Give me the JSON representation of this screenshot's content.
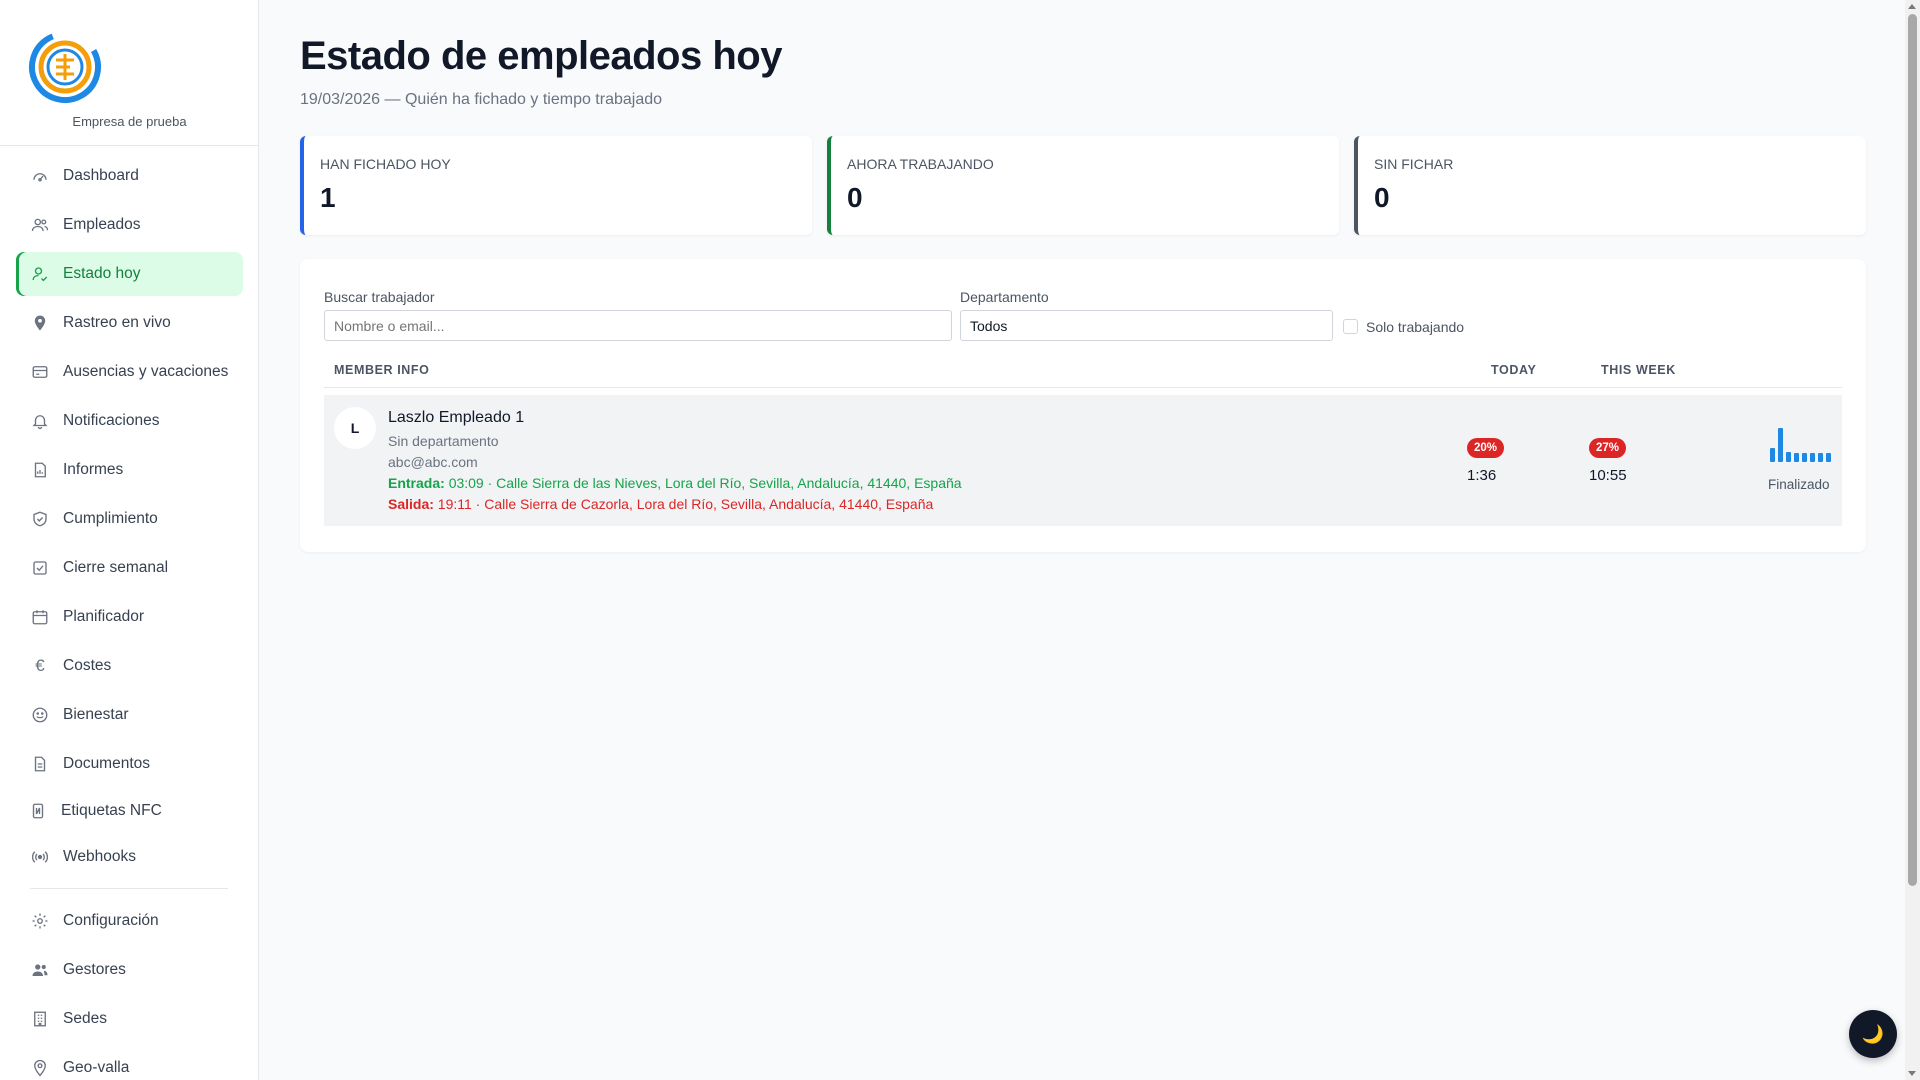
{
  "sidebar": {
    "company": "Empresa de prueba",
    "items": [
      {
        "label": "Dashboard",
        "icon": "gauge-icon"
      },
      {
        "label": "Empleados",
        "icon": "users-icon"
      },
      {
        "label": "Estado hoy",
        "icon": "user-check-icon",
        "active": true
      },
      {
        "label": "Rastreo en vivo",
        "icon": "map-pin-icon"
      },
      {
        "label": "Ausencias y vacaciones",
        "icon": "card-icon"
      },
      {
        "label": "Notificaciones",
        "icon": "bell-icon"
      },
      {
        "label": "Informes",
        "icon": "report-icon"
      },
      {
        "label": "Cumplimiento",
        "icon": "shield-check-icon"
      },
      {
        "label": "Cierre semanal",
        "icon": "check-square-icon"
      },
      {
        "label": "Planificador",
        "icon": "calendar-icon"
      },
      {
        "label": "Costes",
        "icon": "euro-icon"
      },
      {
        "label": "Bienestar",
        "icon": "smile-icon"
      },
      {
        "label": "Documentos",
        "icon": "document-icon"
      },
      {
        "label": "Etiquetas NFC",
        "icon": "nfc-icon"
      },
      {
        "label": "Webhooks",
        "icon": "broadcast-icon"
      }
    ],
    "secondary": [
      {
        "label": "Configuración",
        "icon": "gear-icon"
      },
      {
        "label": "Gestores",
        "icon": "people-icon"
      },
      {
        "label": "Sedes",
        "icon": "building-icon"
      },
      {
        "label": "Geo-valla",
        "icon": "geofence-pin-icon"
      }
    ]
  },
  "header": {
    "title": "Estado de empleados hoy",
    "subtitle": "19/03/2026 — Quién ha fichado y tiempo trabajado"
  },
  "stats": [
    {
      "label": "Han fichado hoy",
      "value": "1",
      "color": "#2563eb"
    },
    {
      "label": "Ahora trabajando",
      "value": "0",
      "color": "#15803d"
    },
    {
      "label": "Sin fichar",
      "value": "0",
      "color": "#4b5563"
    }
  ],
  "filters": {
    "search_label": "Buscar trabajador",
    "search_placeholder": "Nombre o email...",
    "dept_label": "Departamento",
    "dept_value": "Todos",
    "only_working_label": "Solo trabajando",
    "only_working_checked": false
  },
  "table": {
    "headers": {
      "member": "MEMBER INFO",
      "today": "TODAY",
      "week": "THIS WEEK"
    },
    "rows": [
      {
        "initial": "L",
        "name": "Laszlo Empleado 1",
        "department": "Sin departamento",
        "email": "abc@abc.com",
        "entrada_label": "Entrada:",
        "entrada_text": "03:09 · Calle Sierra de las Nieves, Lora del Río, Sevilla, Andalucía, 41440, España",
        "salida_label": "Salida:",
        "salida_text": "19:11 · Calle Sierra de Cazorla, Lora del Río, Sevilla, Andalucía, 41440, España",
        "today_pct": "20%",
        "today_time": "1:36",
        "week_pct": "27%",
        "week_time": "10:55",
        "week_bars": [
          0.4,
          1.0,
          0.3,
          0.25,
          0.25,
          0.25,
          0.25,
          0.25
        ],
        "status": "Finalizado"
      }
    ]
  },
  "ui": {
    "dark_mode_icon": "moon-icon",
    "accent": "#16a34a",
    "danger": "#dc2626"
  }
}
